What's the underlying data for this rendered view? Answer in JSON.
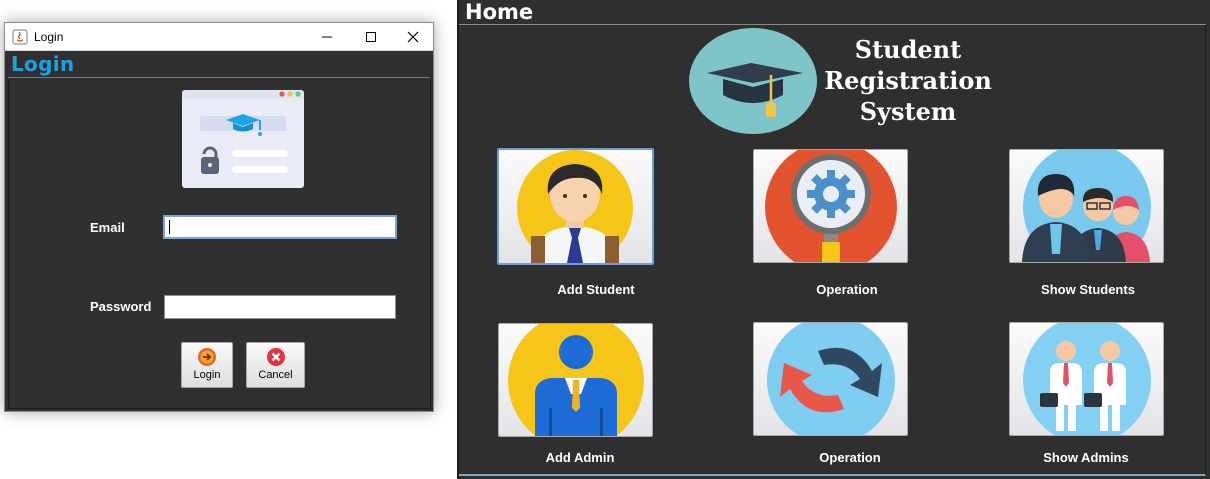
{
  "login_window": {
    "window_title": "Login",
    "heading": "Login",
    "email_label": "Email",
    "email_value": "",
    "password_label": "Password",
    "password_value": "",
    "login_button_label": "Login",
    "cancel_button_label": "Cancel"
  },
  "home_window": {
    "heading": "Home",
    "system_title_lines": [
      "Student",
      "Registration",
      "System"
    ],
    "tiles": [
      {
        "label": "Add Student",
        "icon": "student-icon"
      },
      {
        "label": "Operation",
        "icon": "magnifier-gear-icon"
      },
      {
        "label": "Show Students",
        "icon": "students-group-icon"
      },
      {
        "label": "Add Admin",
        "icon": "admin-icon"
      },
      {
        "label": "Operation",
        "icon": "refresh-arrows-icon"
      },
      {
        "label": "Show Admins",
        "icon": "admins-group-icon"
      }
    ]
  },
  "colors": {
    "accent_blue": "#1ba1e2",
    "panel_dark": "#2f2f2f"
  }
}
